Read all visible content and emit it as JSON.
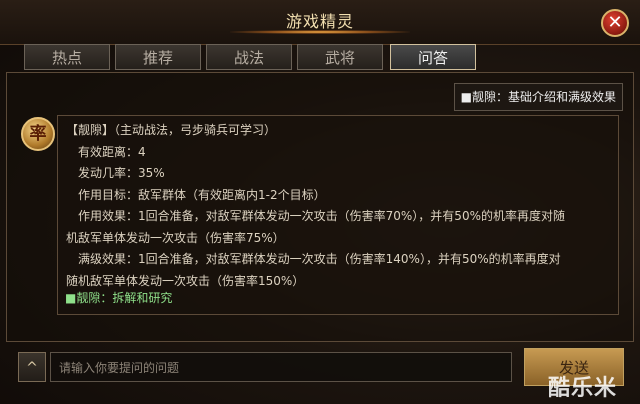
{
  "window": {
    "title": "游戏精灵"
  },
  "tabs": [
    {
      "label": "热点"
    },
    {
      "label": "推荐"
    },
    {
      "label": "战法"
    },
    {
      "label": "武将"
    },
    {
      "label": "问答",
      "active": true
    }
  ],
  "breadcrumb": {
    "label": "■靓隙：基础介绍和满级效果"
  },
  "skill": {
    "icon_char": "率",
    "lines": [
      "【靓隙】（主动战法，弓步骑兵可学习）",
      "有效距离：4",
      "发动几率：35%",
      "作用目标：敌军群体（有效距离内1-2个目标）",
      "作用效果：1回合准备，对敌军群体发动一次攻击（伤害率70%），并有50%的机率再度对随",
      "机敌军单体发动一次攻击（伤害率75%）",
      "满级效果：1回合准备，对敌军群体发动一次攻击（伤害率140%），并有50%的机率再度对",
      "随机敌军单体发动一次攻击（伤害率150%）"
    ],
    "link": "■靓隙：拆解和研究"
  },
  "bottom": {
    "expand_icon": "^",
    "input_placeholder": "请输入你要提问的问题",
    "send_label": "发送"
  },
  "watermark": "酷乐米",
  "colors": {
    "accent_gold": "#d9b36a",
    "link_green": "#8fe08a",
    "close_red": "#c0301f"
  }
}
